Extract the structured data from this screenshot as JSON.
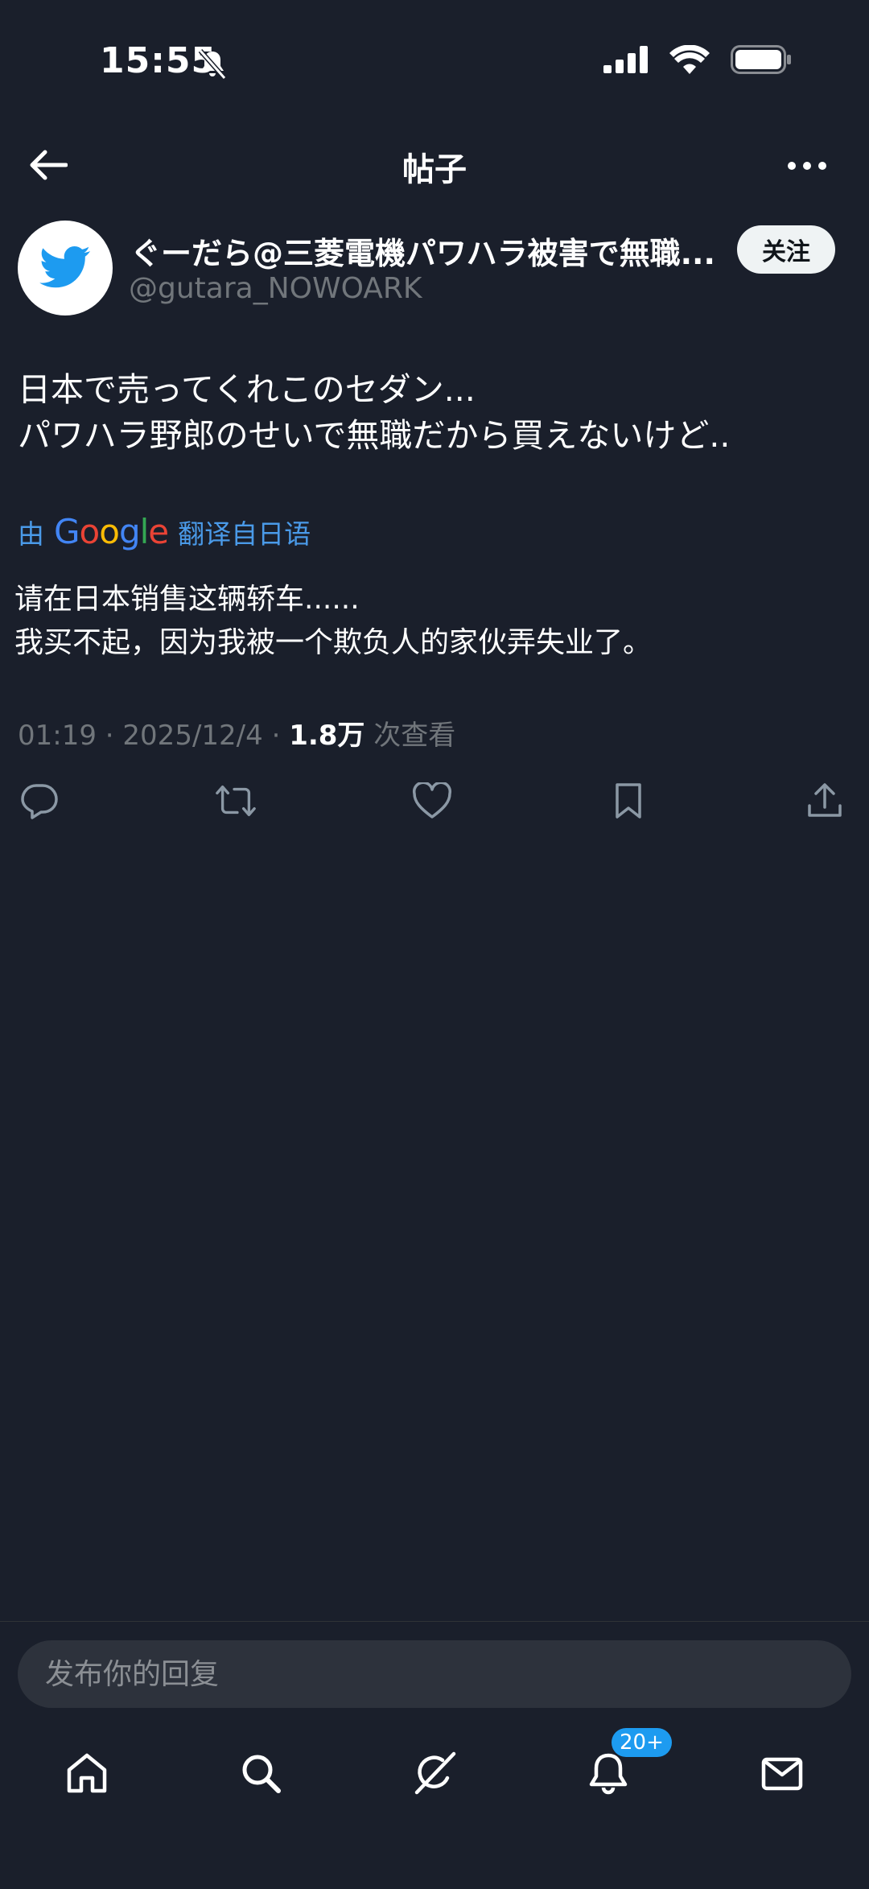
{
  "status_bar": {
    "time": "15:55"
  },
  "header": {
    "title": "帖子"
  },
  "author": {
    "display_name": "ぐーだら@三菱電機パワハラ被害で無職...",
    "handle": "@gutara_NOWOARK",
    "follow_label": "关注"
  },
  "tweet": {
    "lines": [
      "日本で売ってくれこのセダン...",
      "パワハラ野郎のせいで無職だから買えないけど.."
    ],
    "translate_prefix": "由",
    "translate_brand": "Google",
    "translate_label": "翻译自日语",
    "translation_lines": [
      "请在日本销售这辆轿车......",
      "我买不起，因为我被一个欺负人的家伙弄失业了。"
    ],
    "time": "01:19",
    "date": "2025/12/4",
    "views": "1.8万",
    "views_suffix": "次查看"
  },
  "actions": {
    "icons": [
      "reply-icon",
      "retweet-icon",
      "like-icon",
      "bookmark-icon",
      "share-icon"
    ]
  },
  "reply": {
    "placeholder": "发布你的回复"
  },
  "bottom_nav": {
    "items": [
      "home-icon",
      "search-icon",
      "grok-icon",
      "notifications-icon",
      "messages-icon"
    ],
    "notification_badge": "20+"
  },
  "colors": {
    "background": "#1a1f2b",
    "accent": "#1d9bf0",
    "muted": "#71767b"
  }
}
